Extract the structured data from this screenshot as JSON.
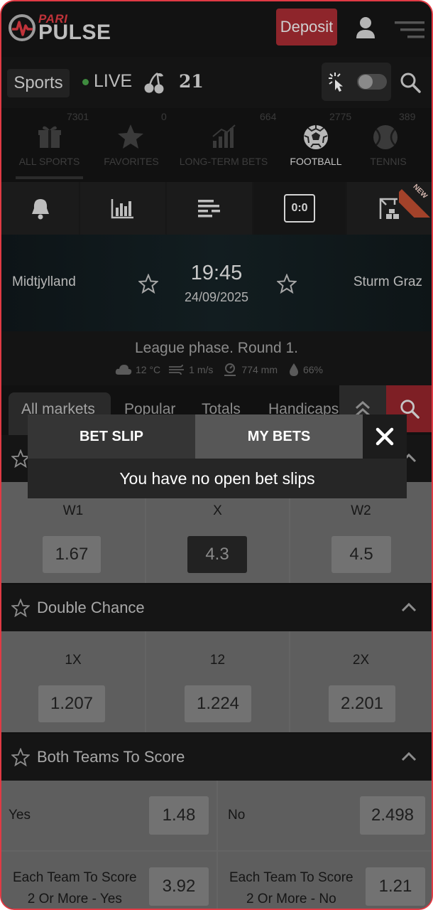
{
  "header": {
    "logo_top": "PARI",
    "logo_bottom": "PULSE",
    "deposit_label": "Deposit"
  },
  "nav": {
    "sports_label": "Sports",
    "live_label": "LIVE",
    "games_label": "21"
  },
  "categories": [
    {
      "label": "ALL SPORTS",
      "count": "7301"
    },
    {
      "label": "FAVORITES",
      "count": "0"
    },
    {
      "label": "LONG-TERM BETS",
      "count": "664"
    },
    {
      "label": "FOOTBALL",
      "count": "2775"
    },
    {
      "label": "TENNIS",
      "count": "389"
    }
  ],
  "tools": {
    "score_label": "0:0",
    "new_badge": "NEW"
  },
  "match": {
    "team_home": "Midtjylland",
    "team_away": "Sturm Graz",
    "time": "19:45",
    "date": "24/09/2025"
  },
  "league": {
    "name": "League phase. Round 1.",
    "temperature": "12 °C",
    "wind": "1 m/s",
    "pressure": "774 mm",
    "humidity": "66%"
  },
  "market_tabs": [
    "All markets",
    "Popular",
    "Totals",
    "Handicaps"
  ],
  "markets": {
    "result": {
      "options": [
        {
          "label": "W1",
          "odd": "1.67"
        },
        {
          "label": "X",
          "odd": "4.3"
        },
        {
          "label": "W2",
          "odd": "4.5"
        }
      ]
    },
    "double_chance": {
      "title": "Double Chance",
      "options": [
        {
          "label": "1X",
          "odd": "1.207"
        },
        {
          "label": "12",
          "odd": "1.224"
        },
        {
          "label": "2X",
          "odd": "2.201"
        }
      ]
    },
    "btts": {
      "title": "Both Teams To Score",
      "rows": [
        {
          "label": "Yes",
          "odd": "1.48"
        },
        {
          "label": "No",
          "odd": "2.498"
        },
        {
          "label_line1": "Each Team To Score",
          "label_line2": "2 Or More - Yes",
          "odd": "3.92"
        },
        {
          "label_line1": "Each Team To Score",
          "label_line2": "2 Or More - No",
          "odd": "1.21"
        }
      ]
    }
  },
  "popup": {
    "tab_bet_slip": "BET SLIP",
    "tab_my_bets": "MY BETS",
    "message": "You have no open bet slips"
  }
}
